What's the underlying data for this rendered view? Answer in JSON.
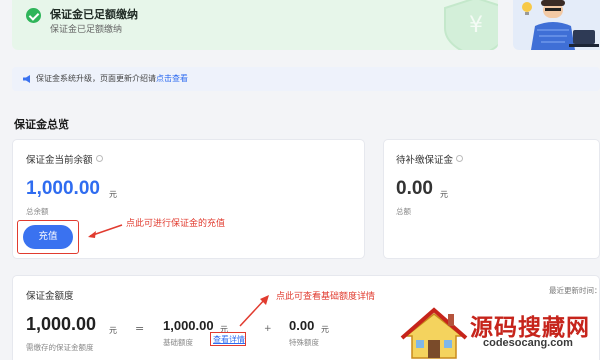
{
  "banner": {
    "title": "保证金已足额缴纳",
    "subtitle": "保证金已足额缴纳"
  },
  "notice": {
    "text": "保证金系统升级，页面更新介绍请",
    "link": "点击查看"
  },
  "overview": {
    "title": "保证金总览"
  },
  "balance_card": {
    "label": "保证金当前余额",
    "amount": "1,000.00",
    "unit": "元",
    "sublabel": "总余额",
    "recharge_button": "充值",
    "annotation": "点此可进行保证金的充值"
  },
  "pending_card": {
    "label": "待补缴保证金",
    "amount": "0.00",
    "unit": "元",
    "sublabel": "总额"
  },
  "quota_card": {
    "label": "保证金额度",
    "updated": "最近更新时间：",
    "annotation": "点此可查看基础额度详情",
    "required_amount": "1,000.00",
    "required_unit": "元",
    "required_label": "需缴存的保证金额度",
    "equals": "=",
    "base_amount": "1,000.00",
    "base_unit": "元",
    "base_label": "基础额度",
    "detail_link": "查看详情",
    "plus": "+",
    "special_amount": "0.00",
    "special_unit": "元",
    "special_label": "特殊额度"
  },
  "watermark": {
    "title": "源码搜藏网",
    "url": "codesocang.com"
  },
  "colors": {
    "accent": "#2f6cf0",
    "success": "#2fb55a",
    "annotation": "#e13b2f",
    "banner_bg": "#e7f6ea"
  }
}
